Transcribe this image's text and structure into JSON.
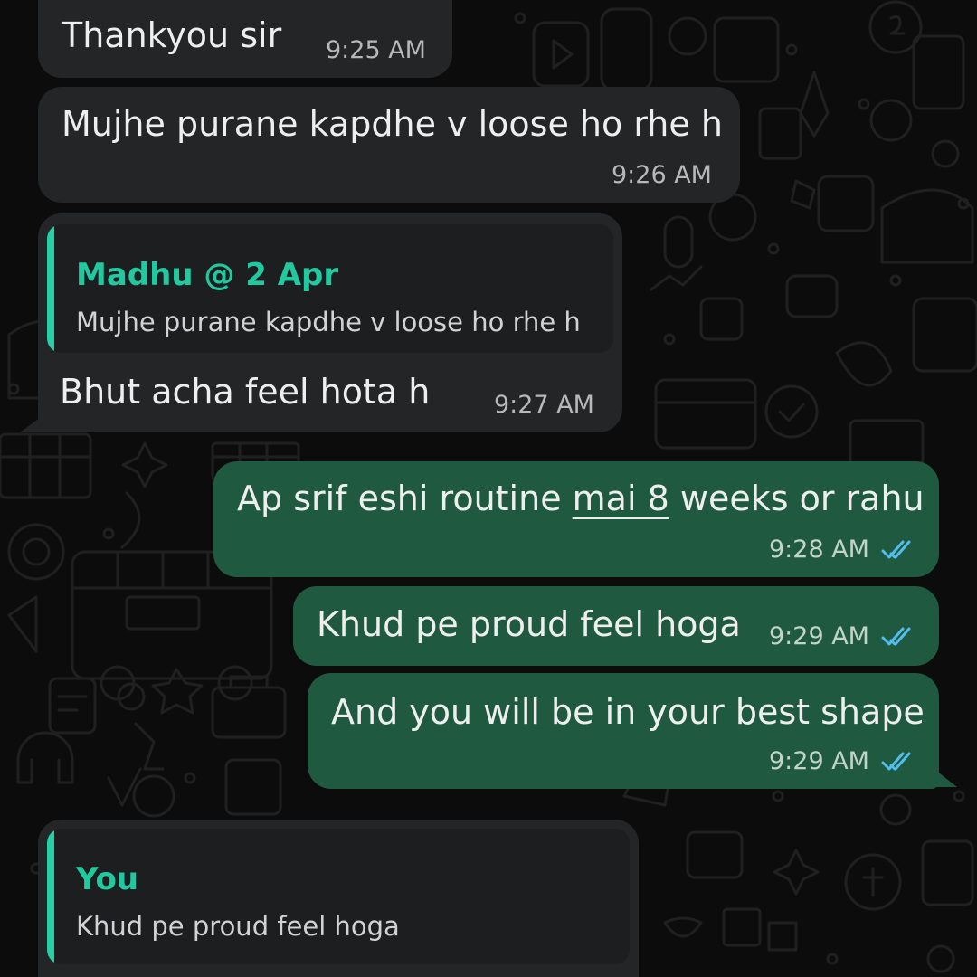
{
  "messages": [
    {
      "text": "Thankyou sir",
      "time": "9:25 AM"
    },
    {
      "text": "Mujhe purane kapdhe v loose ho rhe h",
      "time": "9:26 AM"
    },
    {
      "quote_author": "Madhu @ 2 Apr",
      "quote_text": "Mujhe purane kapdhe v loose ho rhe h",
      "text": "Bhut acha feel hota h",
      "time": "9:27 AM"
    },
    {
      "text_before": "Ap srif eshi routine ",
      "text_link": "mai 8",
      "text_after": " weeks or rahu",
      "time": "9:28 AM"
    },
    {
      "text": "Khud pe proud feel hoga",
      "time": "9:29 AM"
    },
    {
      "text": "And you will be in your best shape",
      "time": "9:29 AM"
    },
    {
      "quote_author": "You",
      "quote_text": "Khud pe proud feel hoga"
    }
  ],
  "colors": {
    "incoming_bubble": "#232527",
    "outgoing_bubble": "#1f5a40",
    "quote_accent": "#25d0a4",
    "read_ticks": "#53bdeb"
  },
  "icons": [
    "double-check-icon",
    "background-doodle-pattern"
  ]
}
